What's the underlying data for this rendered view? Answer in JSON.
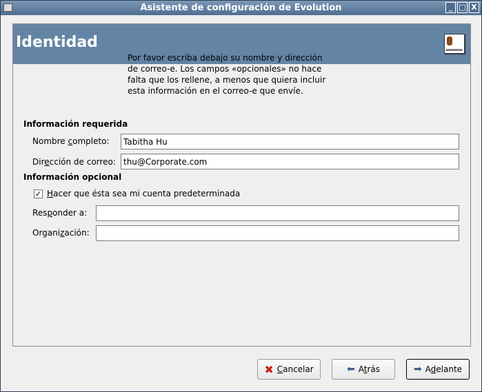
{
  "window": {
    "title": "Asistente de configuración de Evolution"
  },
  "header": {
    "title": "Identidad"
  },
  "intro": "Por favor escriba debajo su nombre y dirección de correo-e. Los campos «opcionales» no hace falta que los rellene, a menos que quiera incluir esta información en el correo-e que envíe.",
  "required": {
    "heading": "Información requerida",
    "name_label_pre": "Nombre ",
    "name_label_u": "c",
    "name_label_post": "ompleto:",
    "name_value": "Tabitha Hu",
    "email_label_pre": "Dir",
    "email_label_u": "e",
    "email_label_post": "cción de correo:",
    "email_value": "thu@Corporate.com"
  },
  "optional": {
    "heading": "Información opcional",
    "default_u": "H",
    "default_post": "acer que ésta sea mi cuenta predeterminada",
    "default_checked": true,
    "reply_pre": "Res",
    "reply_u": "p",
    "reply_post": "onder a:",
    "reply_value": "",
    "org_pre": "Organi",
    "org_u": "z",
    "org_post": "ación:",
    "org_value": ""
  },
  "buttons": {
    "cancel_u": "C",
    "cancel_post": "ancelar",
    "back_pre": "A",
    "back_u": "t",
    "back_post": "rás",
    "next_pre": "A",
    "next_u": "d",
    "next_post": "elante"
  }
}
